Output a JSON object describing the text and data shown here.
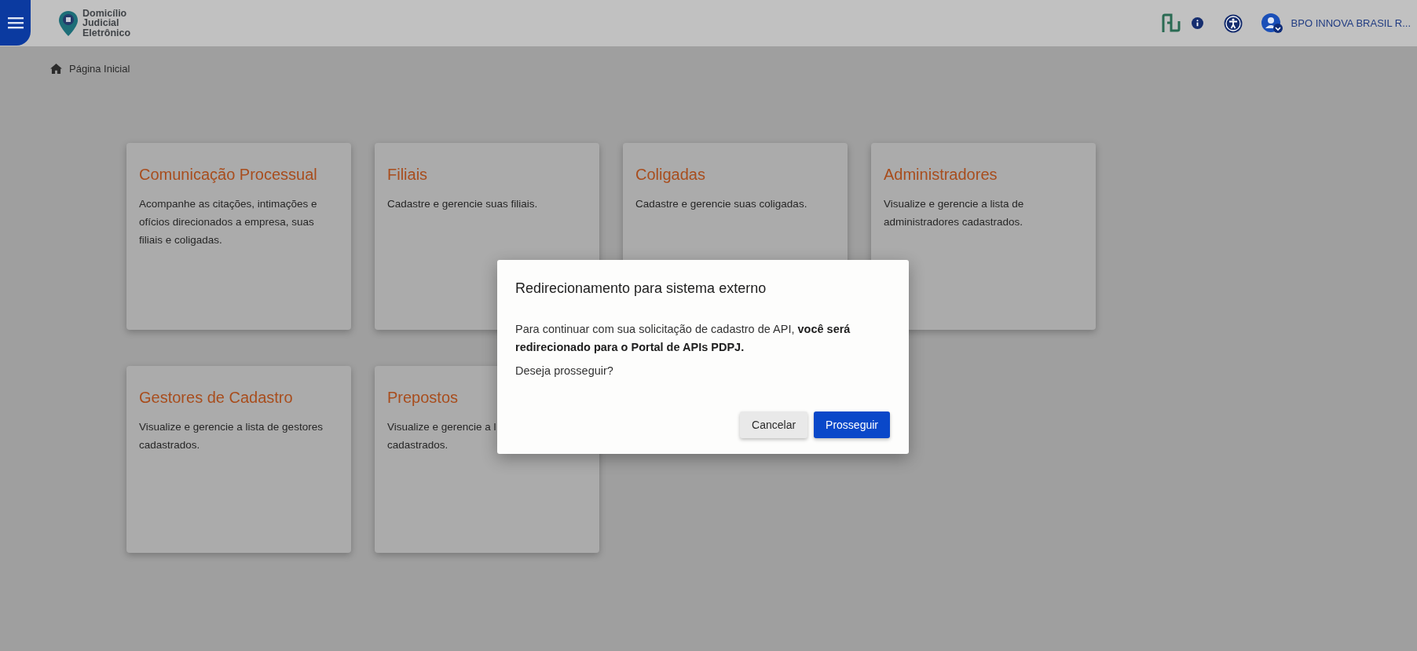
{
  "header": {
    "logo_lines": [
      "Domicílio",
      "Judicial",
      "Eletrônico"
    ],
    "user_name": "BPO INNOVA BRASIL R..."
  },
  "breadcrumb": "Página Inicial",
  "cards": [
    {
      "title": "Comunicação Processual",
      "description": "Acompanhe as citações, intimações e ofícios direcionados a empresa, suas filiais e coligadas."
    },
    {
      "title": "Filiais",
      "description": "Cadastre e gerencie suas filiais."
    },
    {
      "title": "Coligadas",
      "description": "Cadastre e gerencie suas coligadas."
    },
    {
      "title": "Administradores",
      "description": "Visualize e gerencie a lista de administradores cadastrados."
    },
    {
      "title": "Gestores de Cadastro",
      "description": "Visualize e gerencie a lista de gestores cadastrados."
    },
    {
      "title": "Prepostos",
      "description": "Visualize e gerencie a l\ncadastrados."
    }
  ],
  "dialog": {
    "title": "Redirecionamento para sistema externo",
    "body": "Para continuar com sua solicitação de cadastro de API, **você será redirecionado para o Portal de APIs PDPJ.**",
    "question": "Deseja prosseguir?",
    "buttons": [
      {
        "label": "Cancelar",
        "kind": "secondary"
      },
      {
        "label": "Prosseguir",
        "kind": "primary"
      }
    ]
  }
}
